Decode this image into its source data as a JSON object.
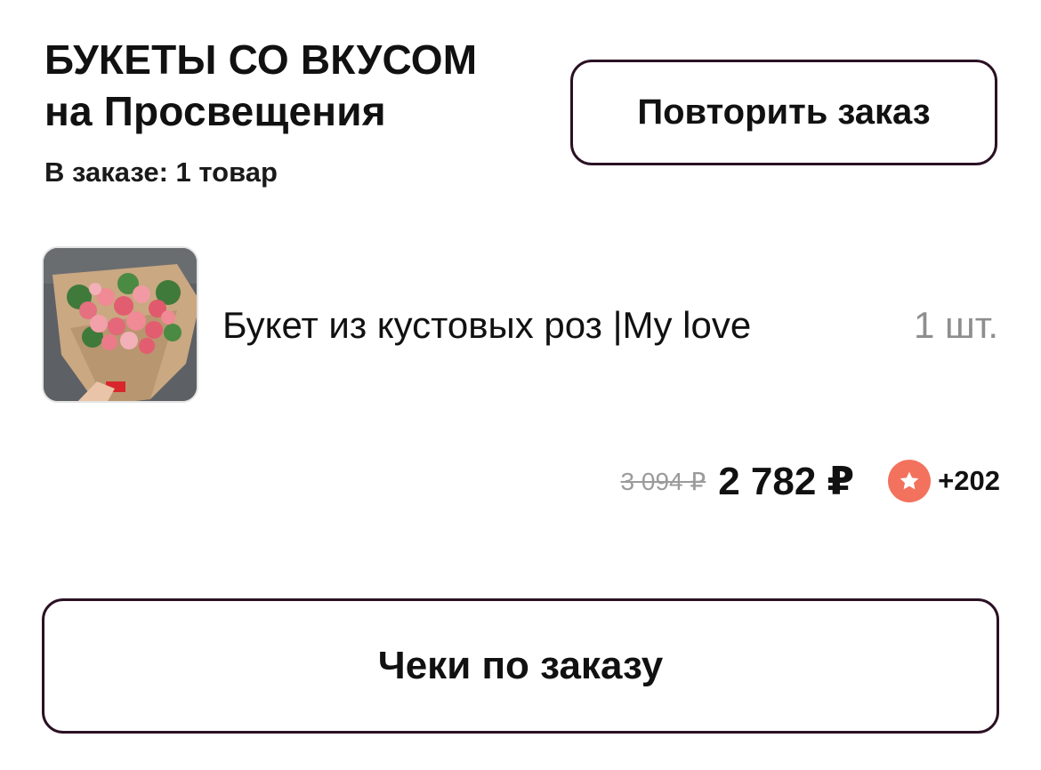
{
  "store": {
    "name_line1": "БУКЕТЫ СО ВКУСОМ",
    "name_line2": "на Просвещения"
  },
  "order": {
    "items_count_label": "В заказе: 1 товар"
  },
  "actions": {
    "repeat_label": "Повторить заказ",
    "receipts_label": "Чеки по заказу"
  },
  "product": {
    "name": "Букет из кустовых роз |My love",
    "quantity": "1 шт.",
    "image_icon": "bouquet-photo"
  },
  "price": {
    "old": "3 094 ₽",
    "current": "2 782 ₽",
    "bonus": "+202",
    "bonus_icon": "star-icon"
  },
  "colors": {
    "button_border": "#2b1124",
    "bonus_badge": "#f2725e",
    "muted_text": "#8e8e8e"
  }
}
